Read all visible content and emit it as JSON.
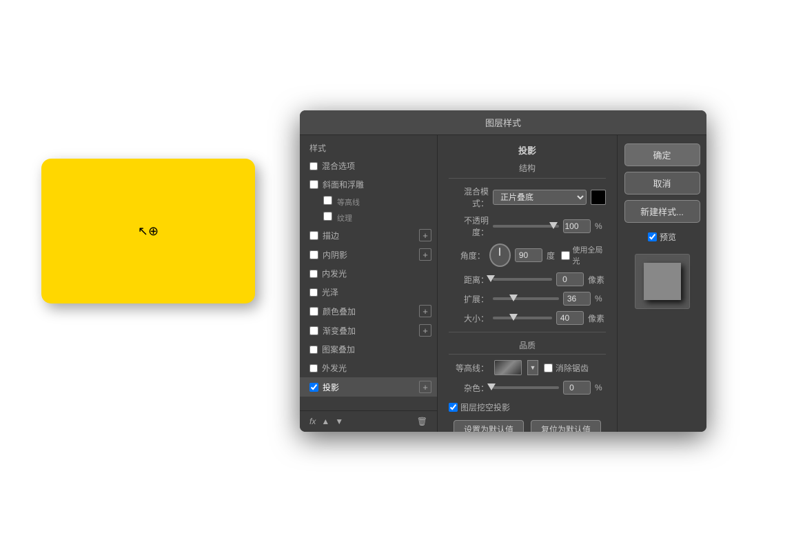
{
  "canvas": {
    "bg_color": "#FFD700"
  },
  "dialog": {
    "title": "图层样式",
    "left_panel": {
      "header": "样式",
      "items": [
        {
          "label": "混合选项",
          "checked": false,
          "hasPlus": false,
          "active": false
        },
        {
          "label": "斜面和浮雕",
          "checked": false,
          "hasPlus": false,
          "active": false
        },
        {
          "label": "等高线",
          "checked": false,
          "hasPlus": false,
          "active": false,
          "sub": true
        },
        {
          "label": "纹理",
          "checked": false,
          "hasPlus": false,
          "active": false,
          "sub": true
        },
        {
          "label": "描边",
          "checked": false,
          "hasPlus": true,
          "active": false
        },
        {
          "label": "内阴影",
          "checked": false,
          "hasPlus": true,
          "active": false
        },
        {
          "label": "内发光",
          "checked": false,
          "hasPlus": false,
          "active": false
        },
        {
          "label": "光泽",
          "checked": false,
          "hasPlus": false,
          "active": false
        },
        {
          "label": "颜色叠加",
          "checked": false,
          "hasPlus": true,
          "active": false
        },
        {
          "label": "渐变叠加",
          "checked": false,
          "hasPlus": true,
          "active": false
        },
        {
          "label": "图案叠加",
          "checked": false,
          "hasPlus": false,
          "active": false
        },
        {
          "label": "外发光",
          "checked": false,
          "hasPlus": false,
          "active": false
        },
        {
          "label": "投影",
          "checked": true,
          "hasPlus": true,
          "active": true
        }
      ],
      "footer": {
        "fx_label": "fx",
        "up_icon": "▲",
        "down_icon": "▼",
        "delete_icon": "🗑"
      }
    },
    "mid_panel": {
      "section_title": "投影",
      "sub_title": "结构",
      "blend_mode_label": "混合模式：",
      "blend_mode_value": "正片叠底",
      "opacity_label": "不透明度：",
      "opacity_value": "100",
      "opacity_unit": "%",
      "angle_label": "角度：",
      "angle_value": "90",
      "angle_unit": "度",
      "global_light_label": "使用全局光",
      "distance_label": "距离：",
      "distance_value": "0",
      "distance_unit": "像素",
      "spread_label": "扩展：",
      "spread_value": "36",
      "spread_unit": "%",
      "size_label": "大小：",
      "size_value": "40",
      "size_unit": "像素",
      "quality_title": "品质",
      "contour_label": "等高线：",
      "anti_alias_label": "消除锯齿",
      "noise_label": "杂色：",
      "noise_value": "0",
      "noise_unit": "%",
      "knockout_label": "图层挖空投影",
      "btn_set_default": "设置为默认值",
      "btn_reset_default": "复位为默认值"
    },
    "right_panel": {
      "ok_label": "确定",
      "cancel_label": "取消",
      "new_style_label": "新建样式...",
      "preview_label": "预览"
    }
  }
}
